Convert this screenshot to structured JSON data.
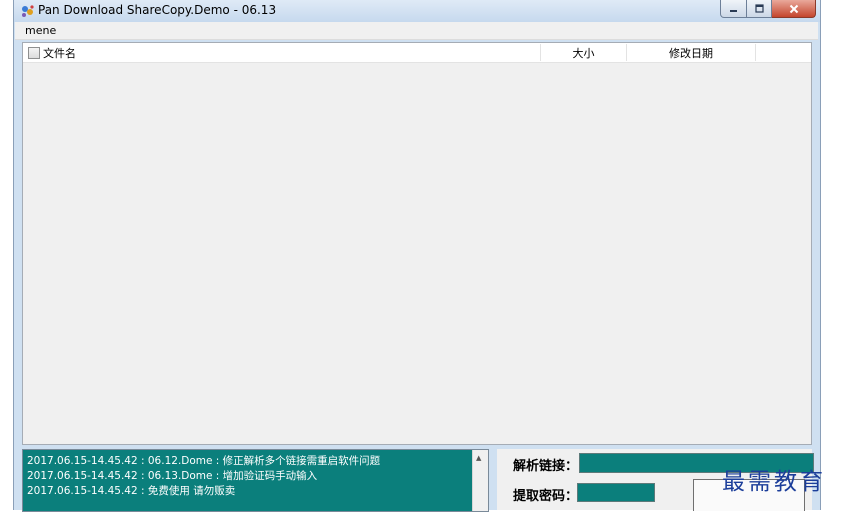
{
  "window": {
    "title": "Pan Download ShareCopy.Demo  -  06.13",
    "icon": "app-paw-icon"
  },
  "menu": {
    "items": [
      "mene"
    ]
  },
  "list": {
    "columns": [
      "文件名",
      "大小",
      "修改日期"
    ],
    "rows": []
  },
  "log": {
    "lines": [
      "2017.06.15-14.45.42 : 06.12.Dome : 修正解析多个链接需重启软件问题",
      "2017.06.15-14.45.42 : 06.13.Dome : 增加验证码手动输入",
      "2017.06.15-14.45.42 : 免费使用 请勿贩卖"
    ]
  },
  "form": {
    "link_label": "解析链接：",
    "link_value": "",
    "password_label": "提取密码：",
    "password_value": ""
  },
  "watermark": "最需教育",
  "colors": {
    "teal": "#0b7f7c",
    "watermark": "#1c3e9a"
  }
}
